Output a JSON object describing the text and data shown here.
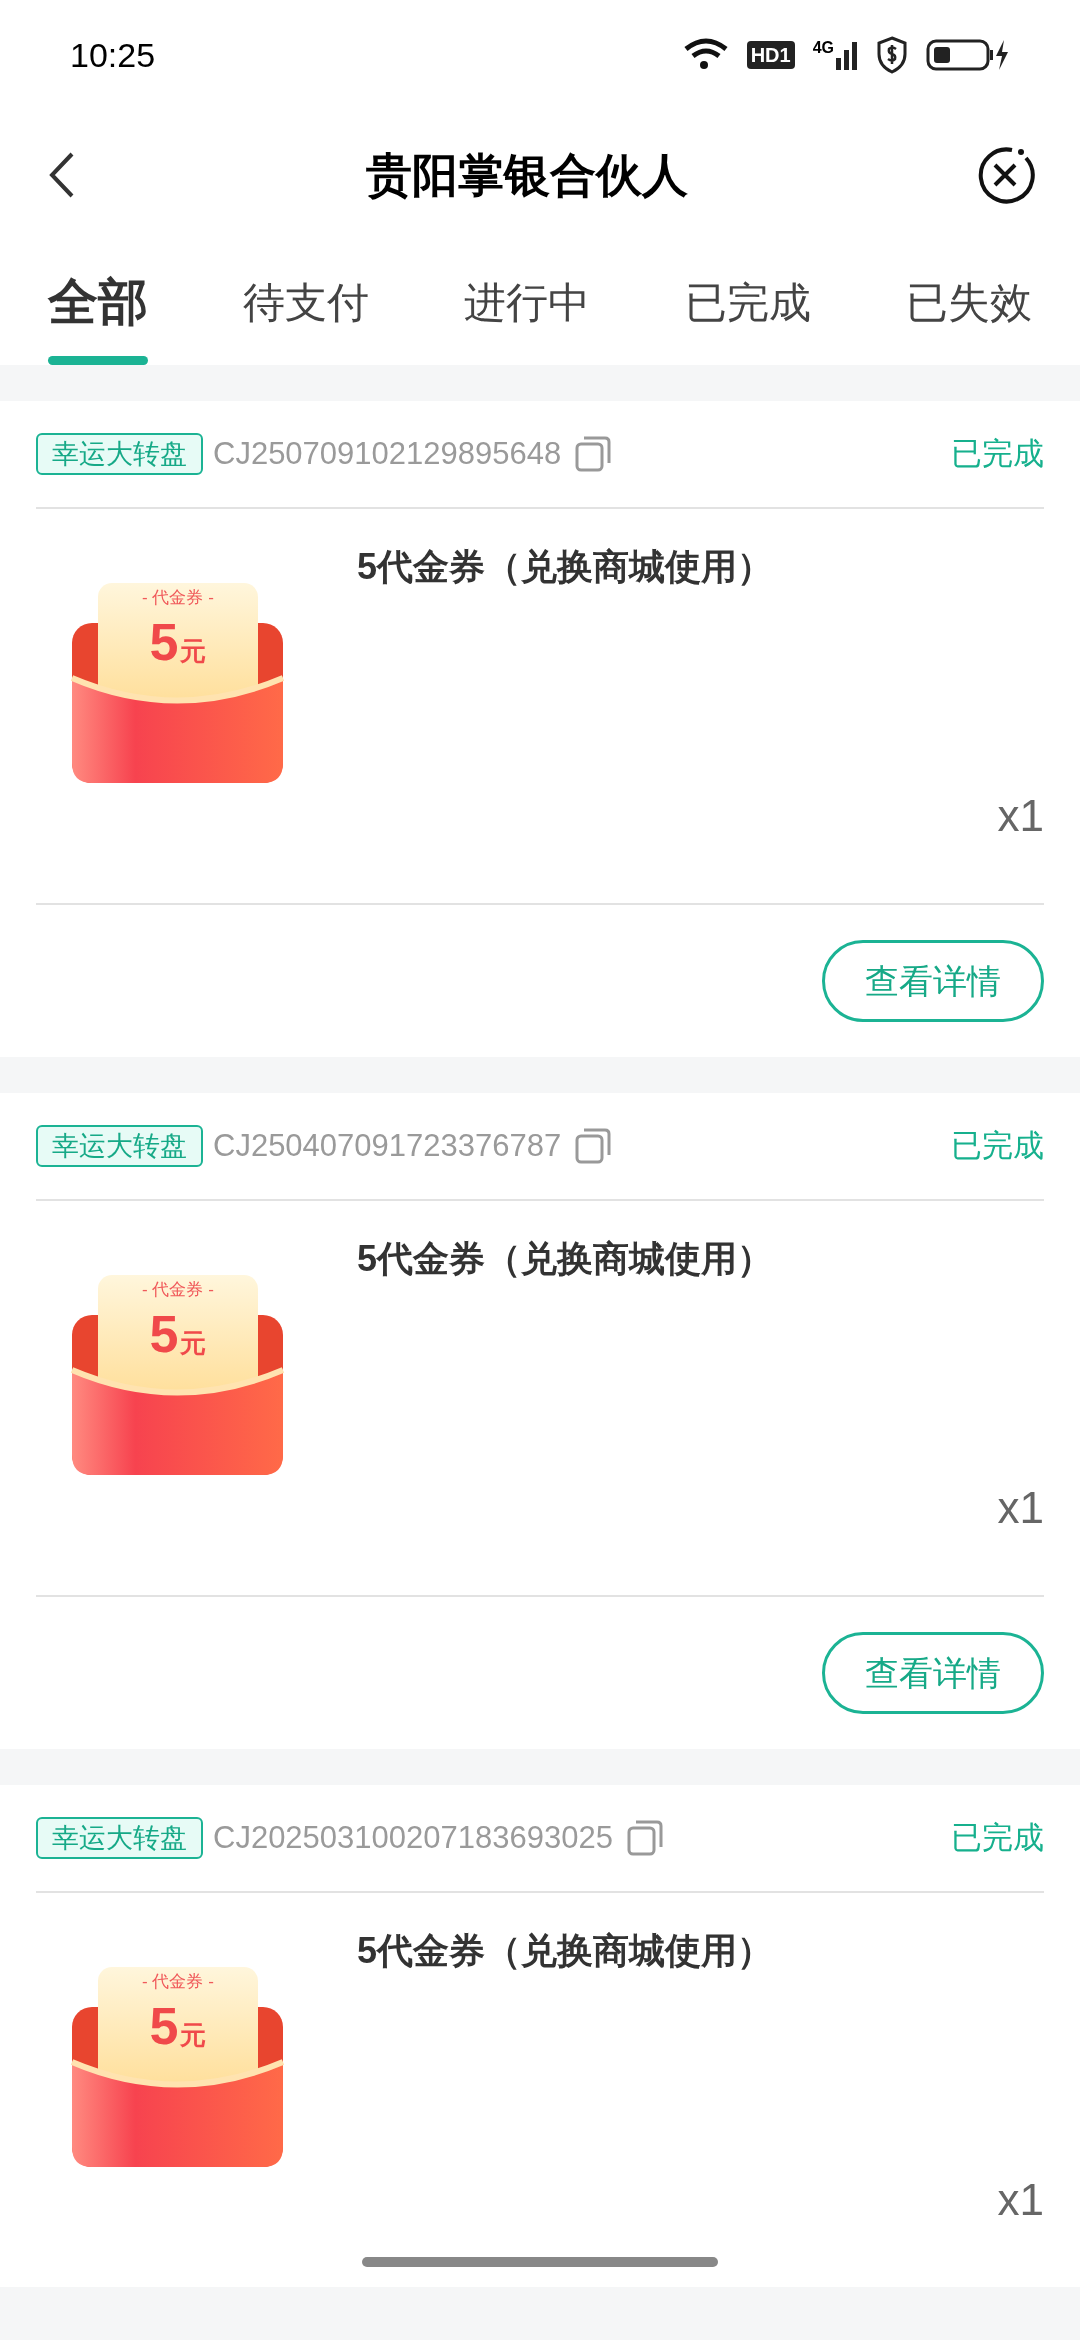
{
  "status_bar": {
    "time": "10:25",
    "hd_badge": "HD1",
    "network": "4G"
  },
  "header": {
    "title": "贵阳掌银合伙人"
  },
  "tabs": [
    {
      "label": "全部",
      "selected": true
    },
    {
      "label": "待支付",
      "selected": false
    },
    {
      "label": "进行中",
      "selected": false
    },
    {
      "label": "已完成",
      "selected": false
    },
    {
      "label": "已失效",
      "selected": false
    }
  ],
  "orders": [
    {
      "tag": "幸运大转盘",
      "order_no": "CJ250709102129895648",
      "status": "已完成",
      "voucher_label": "- 代金券 -",
      "voucher_amount": "5",
      "voucher_unit": "元",
      "title": "5代金券（兑换商城使用）",
      "quantity": "x1",
      "details_button": "查看详情"
    },
    {
      "tag": "幸运大转盘",
      "order_no": "CJ250407091723376787",
      "status": "已完成",
      "voucher_label": "- 代金券 -",
      "voucher_amount": "5",
      "voucher_unit": "元",
      "title": "5代金券（兑换商城使用）",
      "quantity": "x1",
      "details_button": "查看详情"
    },
    {
      "tag": "幸运大转盘",
      "order_no": "CJ202503100207183693025",
      "status": "已完成",
      "voucher_label": "- 代金券 -",
      "voucher_amount": "5",
      "voucher_unit": "元",
      "title": "5代金券（兑换商城使用）",
      "quantity": "x1"
    }
  ]
}
